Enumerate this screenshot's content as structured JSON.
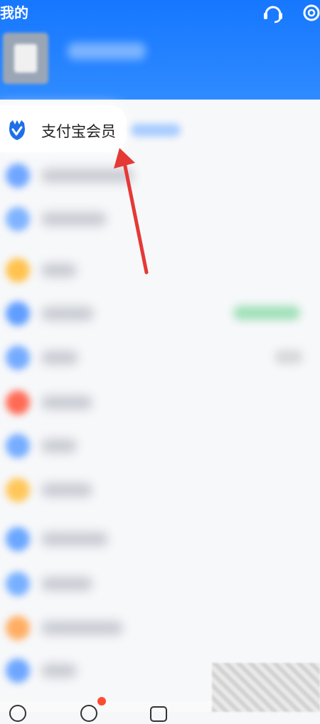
{
  "header": {
    "title": "我的",
    "icons": [
      "customer-service-icon",
      "settings-icon"
    ],
    "brand_color": "#1677ff"
  },
  "member": {
    "label": "支付宝会员",
    "badge_color": "#1677ff"
  },
  "list_rows": [
    {
      "icon_color": "#6fa6ff"
    },
    {
      "icon_color": "#7fb3ff"
    },
    {
      "icon_color": "#ffc24d"
    },
    {
      "icon_color": "#5f9dff"
    },
    {
      "icon_color": "#74abff"
    },
    {
      "icon_color": "#ff6a55"
    },
    {
      "icon_color": "#76adff"
    },
    {
      "icon_color": "#ffc75a"
    },
    {
      "icon_color": "#6aa7ff"
    },
    {
      "icon_color": "#77b0ff"
    },
    {
      "icon_color": "#ffae63"
    },
    {
      "icon_color": "#6ea6ff"
    }
  ],
  "annotation": {
    "arrow_color": "#e53935"
  },
  "bottom_nav": {
    "badge_color": "#ff4b33"
  }
}
